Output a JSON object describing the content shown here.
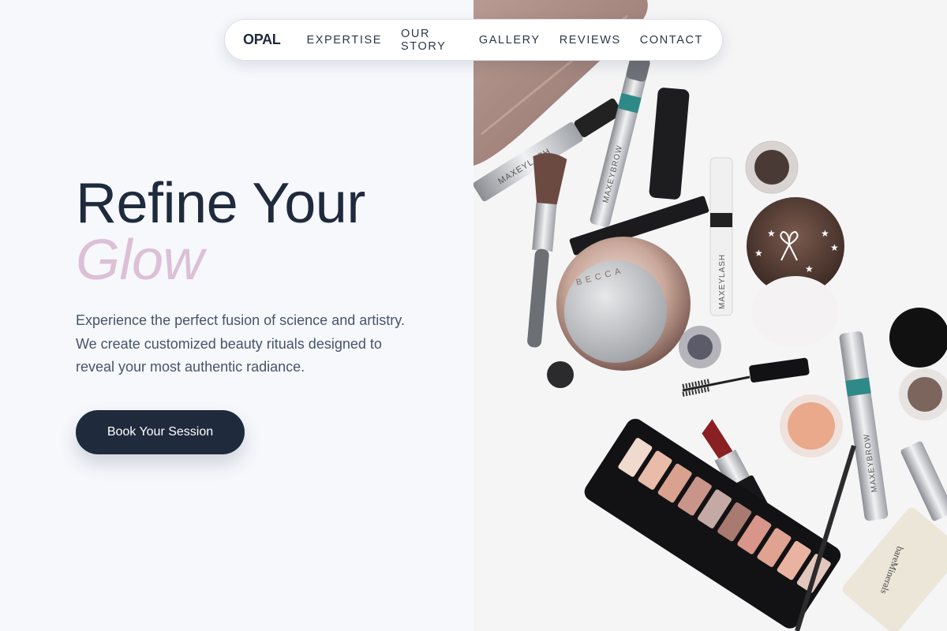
{
  "brand": {
    "logo": "OPAL"
  },
  "nav": {
    "links": [
      "EXPERTISE",
      "OUR STORY",
      "GALLERY",
      "REVIEWS",
      "CONTACT"
    ]
  },
  "hero": {
    "title_line1": "Refine Your",
    "title_line2": "Glow",
    "description": "Experience the perfect fusion of science and artistry. We create customized beauty rituals designed to reveal your most authentic radiance.",
    "cta_label": "Book Your Session"
  },
  "image": {
    "product_labels": [
      "MAXEYLASH",
      "MAXEYBROW",
      "MAXEYLASH",
      "MAXEYBROW"
    ],
    "palette_brand": "BECCA",
    "tube_brand": "bareMinerals"
  },
  "colors": {
    "navy": "#1f2a3d",
    "accent_mauve": "#dcc0d6",
    "background": "#f6f8fc",
    "body_text": "#475469"
  }
}
